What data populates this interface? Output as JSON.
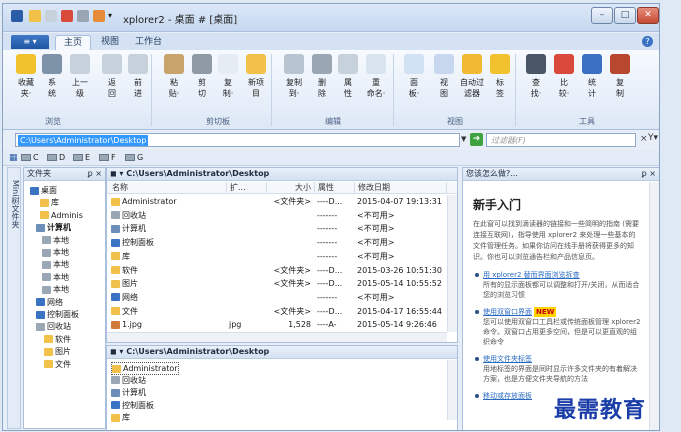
{
  "window": {
    "title": "xplorer2 - 桌面 # [桌面]"
  },
  "ribbon": {
    "file_menu": "",
    "tabs": [
      "主页",
      "视图",
      "工作台"
    ],
    "active_tab": "主页",
    "buttons": [
      {
        "l1": "收藏",
        "l2": "夹·",
        "icon": "star-icon",
        "color": "#f2c12e"
      },
      {
        "l1": "系",
        "l2": "统",
        "icon": "system-icon",
        "color": "#7f93a8"
      },
      {
        "l1": "上一",
        "l2": "级",
        "icon": "up-arrow-icon",
        "color": "#c7d1dc"
      },
      {
        "l1": "返",
        "l2": "回",
        "icon": "back-arrow-icon",
        "color": "#c7d1dc"
      },
      {
        "l1": "前",
        "l2": "进",
        "icon": "forward-arrow-icon",
        "color": "#c7d1dc"
      },
      {
        "l1": "粘",
        "l2": "贴·",
        "icon": "paste-icon",
        "color": "#c9a46a"
      },
      {
        "l1": "剪",
        "l2": "切",
        "icon": "scissors-icon",
        "color": "#8f9aa6"
      },
      {
        "l1": "复",
        "l2": "制·",
        "icon": "copy-icon",
        "color": "#e6ecf3"
      },
      {
        "l1": "新项",
        "l2": "目",
        "icon": "new-folder-icon",
        "color": "#f2c14a"
      },
      {
        "l1": "复制",
        "l2": "到·",
        "icon": "copy-to-icon",
        "color": "#b8c4d1"
      },
      {
        "l1": "删",
        "l2": "除",
        "icon": "delete-icon",
        "color": "#9aa6b3"
      },
      {
        "l1": "属",
        "l2": "性",
        "icon": "properties-icon",
        "color": "#c7d1dc"
      },
      {
        "l1": "重",
        "l2": "命名·",
        "icon": "rename-icon",
        "color": "#d8e3ef"
      },
      {
        "l1": "面",
        "l2": "板·",
        "icon": "panels-icon",
        "color": "#d1e2f5"
      },
      {
        "l1": "视",
        "l2": "图",
        "icon": "view-icon",
        "color": "#c7d8ee"
      },
      {
        "l1": "自动过",
        "l2": "滤器",
        "icon": "filter-icon",
        "color": "#f2b933"
      },
      {
        "l1": "标",
        "l2": "签",
        "icon": "tag-icon",
        "color": "#f2c12e"
      },
      {
        "l1": "查",
        "l2": "找·",
        "icon": "find-icon",
        "color": "#4a5566"
      },
      {
        "l1": "比",
        "l2": "较·",
        "icon": "compare-icon",
        "color": "#d94a3a"
      },
      {
        "l1": "统",
        "l2": "计",
        "icon": "stats-icon",
        "color": "#3a6fc4"
      },
      {
        "l1": "复",
        "l2": "制",
        "icon": "duplicate-icon",
        "color": "#b8472f"
      }
    ],
    "groups": [
      "浏览",
      "剪切板",
      "编辑",
      "视图",
      "工具"
    ]
  },
  "address": {
    "path": "C:\\Users\\Administrator\\Desktop",
    "filter_placeholder": "过滤器(F)"
  },
  "drives": [
    "C",
    "D",
    "E",
    "F",
    "G"
  ],
  "tree": {
    "header": "文件夹",
    "vertical_tab": "Mini树文件夹",
    "items": [
      {
        "label": "桌面",
        "color": "#3a73c4"
      },
      {
        "label": "库",
        "color": "#f2c14a"
      },
      {
        "label": "Adminis",
        "color": "#f2c14a"
      },
      {
        "label": "计算机",
        "color": "#6b8fb8"
      },
      {
        "label": "本地",
        "color": "#9aa7b5"
      },
      {
        "label": "本地",
        "color": "#9aa7b5"
      },
      {
        "label": "本地",
        "color": "#9aa7b5"
      },
      {
        "label": "本地",
        "color": "#9aa7b5"
      },
      {
        "label": "本地",
        "color": "#9aa7b5"
      },
      {
        "label": "网络",
        "color": "#3a73c4"
      },
      {
        "label": "控制面板",
        "color": "#3a73c4"
      },
      {
        "label": "回收站",
        "color": "#9aa7b5"
      },
      {
        "label": "软件",
        "color": "#f2c14a"
      },
      {
        "label": "图片",
        "color": "#f2c14a"
      },
      {
        "label": "文件",
        "color": "#f2c14a"
      }
    ]
  },
  "pane1": {
    "header": "C:\\Users\\Administrator\\Desktop",
    "columns": [
      "名称",
      "扩...",
      "大小",
      "属性",
      "修改日期"
    ],
    "rows": [
      {
        "name": "Administrator",
        "ext": "",
        "size": "<文件夹>",
        "attr": "----D...",
        "date": "2015-04-07 19:13:31",
        "color": "#f2c14a"
      },
      {
        "name": "回收站",
        "ext": "",
        "size": "",
        "attr": "-------",
        "date": "<不可用>",
        "color": "#9aa7b5"
      },
      {
        "name": "计算机",
        "ext": "",
        "size": "",
        "attr": "-------",
        "date": "<不可用>",
        "color": "#6b8fb8"
      },
      {
        "name": "控制面板",
        "ext": "",
        "size": "",
        "attr": "-------",
        "date": "<不可用>",
        "color": "#3a73c4"
      },
      {
        "name": "库",
        "ext": "",
        "size": "",
        "attr": "-------",
        "date": "<不可用>",
        "color": "#f2c14a"
      },
      {
        "name": "软件",
        "ext": "",
        "size": "<文件夹>",
        "attr": "----D...",
        "date": "2015-03-26 10:51:30",
        "color": "#f2c14a"
      },
      {
        "name": "图片",
        "ext": "",
        "size": "<文件夹>",
        "attr": "----D...",
        "date": "2015-05-14 10:55:52",
        "color": "#f2c14a"
      },
      {
        "name": "网络",
        "ext": "",
        "size": "",
        "attr": "-------",
        "date": "<不可用>",
        "color": "#3a73c4"
      },
      {
        "name": "文件",
        "ext": "",
        "size": "<文件夹>",
        "attr": "----D...",
        "date": "2015-04-17 16:55:44",
        "color": "#f2c14a"
      },
      {
        "name": "1.jpg",
        "ext": "jpg",
        "size": "1,528",
        "attr": "----A-",
        "date": "2015-05-14 9:26:46",
        "color": "#cf7a3a"
      }
    ]
  },
  "pane2": {
    "header": "C:\\Users\\Administrator\\Desktop",
    "rows": [
      {
        "name": "Administrator",
        "color": "#f2c14a"
      },
      {
        "name": "回收站",
        "color": "#9aa7b5"
      },
      {
        "name": "计算机",
        "color": "#6b8fb8"
      },
      {
        "name": "控制面板",
        "color": "#3a73c4"
      },
      {
        "name": "库",
        "color": "#f2c14a"
      }
    ]
  },
  "info": {
    "header": "您该怎么做?...",
    "title": "新手入门",
    "para": "在此窗可以找到滴读器的链接和一些简明的指南 (需要连接互联网)，指导使用 xplorer2 来处理一些基本的文件管理任务。如果你访问在线手册将获得更多的知识。你也可以浏览通告栏和产品信息页。",
    "bullets": [
      {
        "link": "用 xplorer2 替而界面浏览拆查",
        "text": "所有的显示面板都可以调整和打开/关闭，从而适合您的浏览习惯",
        "new": ""
      },
      {
        "link": "使用双窗口界面",
        "text": "您可以使用双窗口工具栏或传统面板管理 xplorer2 命令。双窗口占用更多空间，但是可以更直观的组织命令",
        "new": "NEW"
      },
      {
        "link": "使用文件夹标签",
        "text": "用地标签的界面是同时显示许多文件夹的有着解决方案，也是方便文件夹导航的方法",
        "new": ""
      },
      {
        "link": "移动或存放面板",
        "text": "",
        "new": ""
      }
    ]
  },
  "watermark": "最需教育"
}
